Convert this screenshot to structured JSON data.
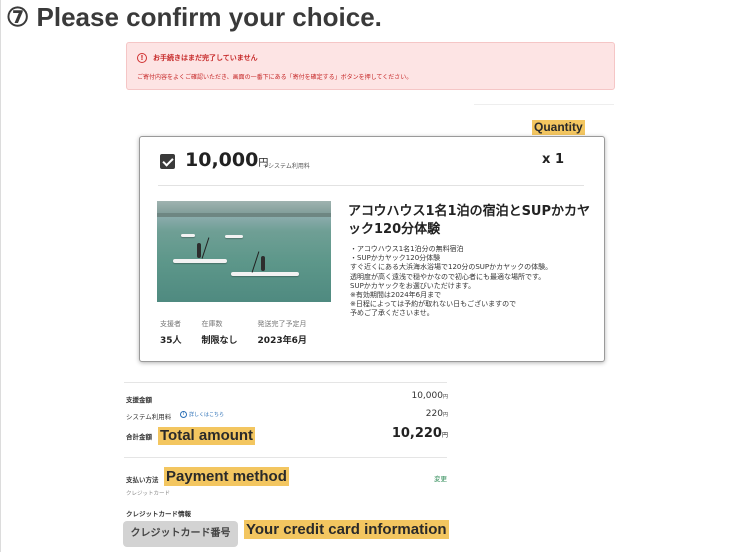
{
  "step_title": "⑦ Please confirm your choice.",
  "alert": {
    "icon": "alert-circle-icon",
    "title": "お手続きはまだ完了していません",
    "body": "ご寄付内容をよくご確認いただき、画面の一番下にある「寄付を確定する」ボタンを押してください。",
    "color": "#c62828"
  },
  "annotations": {
    "quantity": "Quantity",
    "total_amount": "Total amount",
    "payment_method": "Payment method",
    "credit_card_info": "Your credit card information",
    "highlight_color": "#f3c660"
  },
  "product": {
    "checked": true,
    "price": "10,000",
    "price_unit": "円",
    "price_note": "+システム利用料",
    "quantity": "x 1",
    "title": "アコウハウス1名1泊の宿泊とSUPかカヤック120分体験",
    "description": [
      "・アコウハウス1名1泊分の無料宿泊",
      "・SUPかカヤック120分体験",
      "すぐ近くにある大浜海水浴場で120分のSUPかカヤックの体験。",
      "透明度が高く遠浅で穏やかなので初心者にも最適な場所です。",
      "SUPかカヤックをお選びいただけます。",
      "※有効期間は2024年6月まで",
      "※日程によっては予約が取れない日もございますので",
      "予めご了承くださいませ。"
    ],
    "stats": [
      {
        "label": "支援者",
        "value": "35人"
      },
      {
        "label": "在庫数",
        "value": "制限なし"
      },
      {
        "label": "発送完了予定月",
        "value": "2023年6月"
      }
    ]
  },
  "summary": {
    "support_label": "支援金額",
    "support_value": "10,000",
    "system_fee_label": "システム利用料",
    "system_fee_link": "詳しくはこちら",
    "system_fee_value": "220",
    "total_label": "合計金額",
    "total_value": "10,220",
    "yen": "円"
  },
  "payment": {
    "label": "支払い方法",
    "method": "クレジットカード",
    "change": "変更",
    "card_info_label": "クレジットカード情報",
    "card_number_button": "クレジットカード番号"
  }
}
